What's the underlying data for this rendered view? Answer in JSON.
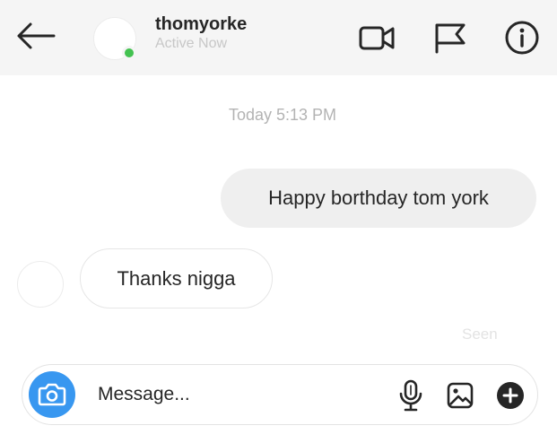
{
  "header": {
    "username": "thomyorke",
    "status": "Active Now",
    "icons": [
      "back-arrow-icon",
      "video-camera-icon",
      "flag-icon",
      "info-icon"
    ],
    "online_color": "#43c250"
  },
  "thread": {
    "timestamp": "Today 5:13 PM",
    "messages": [
      {
        "direction": "outgoing",
        "text": "Happy borthday tom york"
      },
      {
        "direction": "incoming",
        "text": "Thanks nigga"
      }
    ],
    "seen_label": "Seen"
  },
  "composer": {
    "placeholder": "Message...",
    "icons": [
      "camera-icon",
      "microphone-icon",
      "gallery-icon",
      "plus-icon"
    ],
    "camera_color": "#3897f0"
  }
}
